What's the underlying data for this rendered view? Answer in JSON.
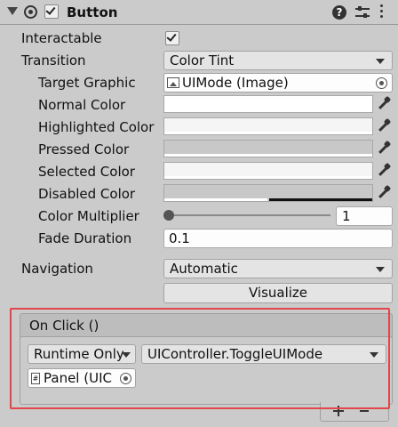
{
  "component": {
    "title": "Button",
    "enabled": true,
    "icons": [
      "foldout-arrow-icon",
      "component-icon",
      "help-icon",
      "presets-icon",
      "kebab-menu-icon"
    ]
  },
  "fields": {
    "interactable_label": "Interactable",
    "interactable_checked": true,
    "transition_label": "Transition",
    "transition_value": "Color Tint",
    "target_graphic_label": "Target Graphic",
    "target_graphic_value": "UIMode (Image)",
    "normal_color_label": "Normal Color",
    "highlighted_color_label": "Highlighted Color",
    "pressed_color_label": "Pressed Color",
    "selected_color_label": "Selected Color",
    "disabled_color_label": "Disabled Color",
    "color_multiplier_label": "Color Multiplier",
    "color_multiplier_value": "1",
    "fade_duration_label": "Fade Duration",
    "fade_duration_value": "0.1",
    "navigation_label": "Navigation",
    "navigation_value": "Automatic",
    "visualize_label": "Visualize"
  },
  "colors": {
    "normal": "#ffffff",
    "highlighted": "#f5f5f5",
    "pressed": "#c8c8c8",
    "selected": "#f5f5f5",
    "disabled": "#c8c8c8",
    "highlight_outline": "#e2454a"
  },
  "on_click": {
    "header": "On Click ()",
    "runtime_value": "Runtime Only",
    "function_value": "UIController.ToggleUIMode",
    "object_value": "Panel (UIC"
  }
}
